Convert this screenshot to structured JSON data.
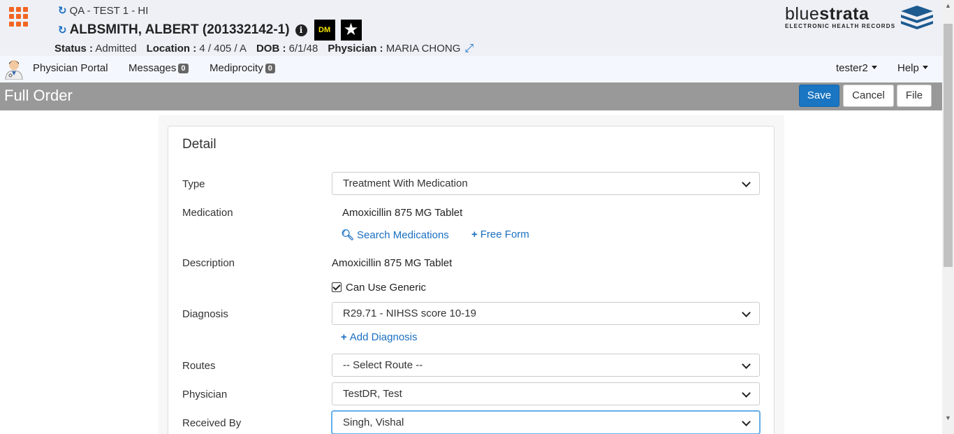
{
  "header": {
    "env": "QA - TEST 1 - HI",
    "patient_name": "ALBSMITH, ALBERT (201332142-1)",
    "badge_dm": "DM",
    "status_label": "Status :",
    "status_value": "Admitted",
    "location_label": "Location :",
    "location_value": "4 / 405 / A",
    "dob_label": "DOB :",
    "dob_value": "6/1/48",
    "physician_label": "Physician :",
    "physician_value": "MARIA CHONG"
  },
  "logo": {
    "brand_light": "blue",
    "brand_bold": "strata",
    "tagline": "ELECTRONIC HEALTH RECORDS"
  },
  "nav": {
    "physician_portal": "Physician Portal",
    "messages": "Messages",
    "messages_count": "0",
    "mediprocity": "Mediprocity",
    "mediprocity_count": "0",
    "user": "tester2",
    "help": "Help"
  },
  "toolbar": {
    "title": "Full Order",
    "save": "Save",
    "cancel": "Cancel",
    "file": "File"
  },
  "form": {
    "section_title": "Detail",
    "type_label": "Type",
    "type_value": "Treatment With Medication",
    "medication_label": "Medication",
    "medication_value": "Amoxicillin 875 MG Tablet",
    "search_medications": "Search Medications",
    "free_form": "Free Form",
    "description_label": "Description",
    "description_value": "Amoxicillin 875 MG Tablet",
    "can_use_generic": "Can Use Generic",
    "diagnosis_label": "Diagnosis",
    "diagnosis_value": "R29.71 - NIHSS score 10-19",
    "add_diagnosis": "Add Diagnosis",
    "routes_label": "Routes",
    "routes_value": "-- Select Route --",
    "physician_label": "Physician",
    "physician_value": "TestDR, Test",
    "received_by_label": "Received By",
    "received_by_value": "Singh, Vishal"
  },
  "colors": {
    "accent": "#1a75c2",
    "apps_icon": "#f26522",
    "titlebar": "#999999",
    "header_bg": "#eef0f6"
  }
}
